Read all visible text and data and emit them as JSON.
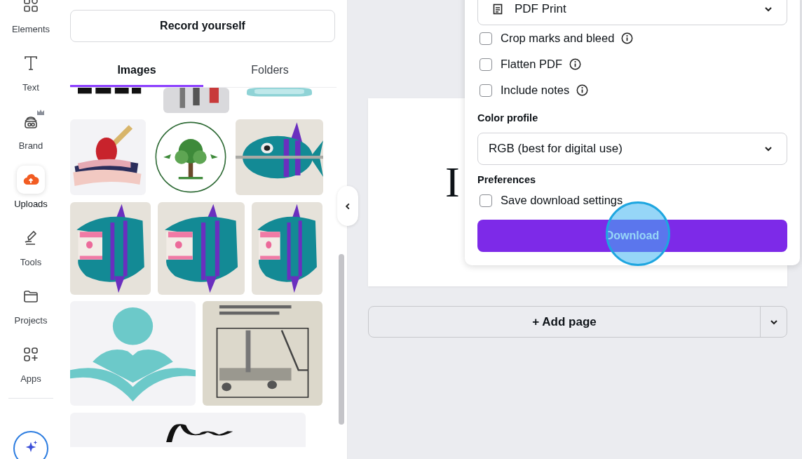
{
  "rail": {
    "items": [
      {
        "label": "Elements",
        "selected": false
      },
      {
        "label": "Text",
        "selected": false
      },
      {
        "label": "Brand",
        "selected": false
      },
      {
        "label": "Uploads",
        "selected": true
      },
      {
        "label": "Tools",
        "selected": false
      },
      {
        "label": "Projects",
        "selected": false
      },
      {
        "label": "Apps",
        "selected": false
      }
    ]
  },
  "panel": {
    "record_button": "Record yourself",
    "tabs": [
      {
        "label": "Images",
        "selected": true
      },
      {
        "label": "Folders",
        "selected": false
      }
    ]
  },
  "canvas": {
    "page_text": "I",
    "add_page": "+ Add page"
  },
  "download_dialog": {
    "file_type": "PDF Print",
    "options": [
      {
        "label": "Crop marks and bleed",
        "checked": false
      },
      {
        "label": "Flatten PDF",
        "checked": false
      },
      {
        "label": "Include notes",
        "checked": false
      }
    ],
    "color_profile_label": "Color profile",
    "color_profile": "RGB (best for digital use)",
    "preferences_label": "Preferences",
    "save_setting": {
      "label": "Save download settings",
      "checked": false
    },
    "download_button": "Download"
  }
}
